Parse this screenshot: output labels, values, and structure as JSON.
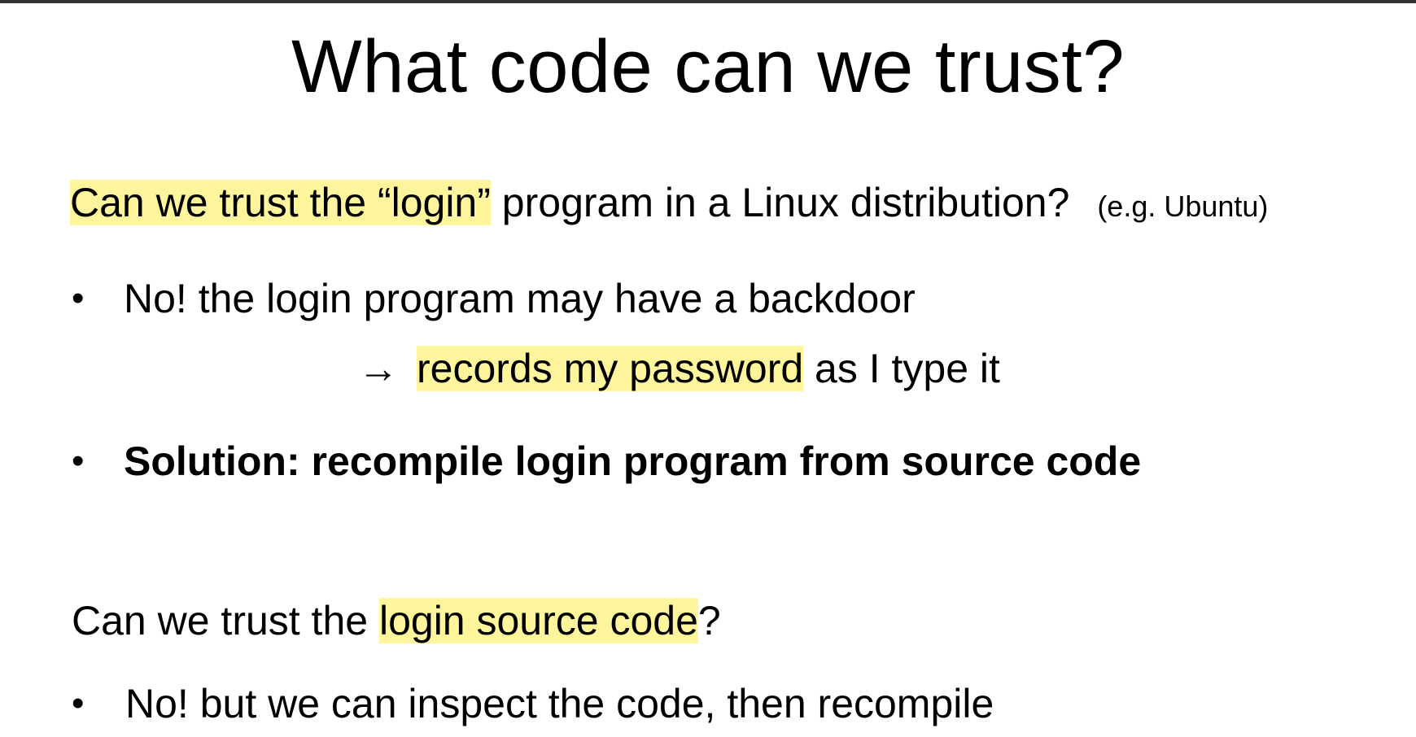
{
  "slide": {
    "title": "What code can we trust?",
    "q1": {
      "highlighted": "Can we trust the “login”",
      "rest": " program in a Linux distribution?",
      "note": "(e.g. Ubuntu)"
    },
    "bullet_char": "•",
    "b1": {
      "text": "No!   the login program may have a backdoor"
    },
    "sub1": {
      "arrow": "→",
      "highlighted": "records my password",
      "rest": " as I type it"
    },
    "b2": {
      "text": "Solution:   recompile  login  program from source code"
    },
    "q2": {
      "before": "Can we trust the ",
      "highlighted": "login source code",
      "after": "?"
    },
    "b3": {
      "text": "No!    but we can inspect the code, then recompile"
    }
  },
  "colors": {
    "highlight": "#fff59d",
    "top_border": "#333333"
  }
}
